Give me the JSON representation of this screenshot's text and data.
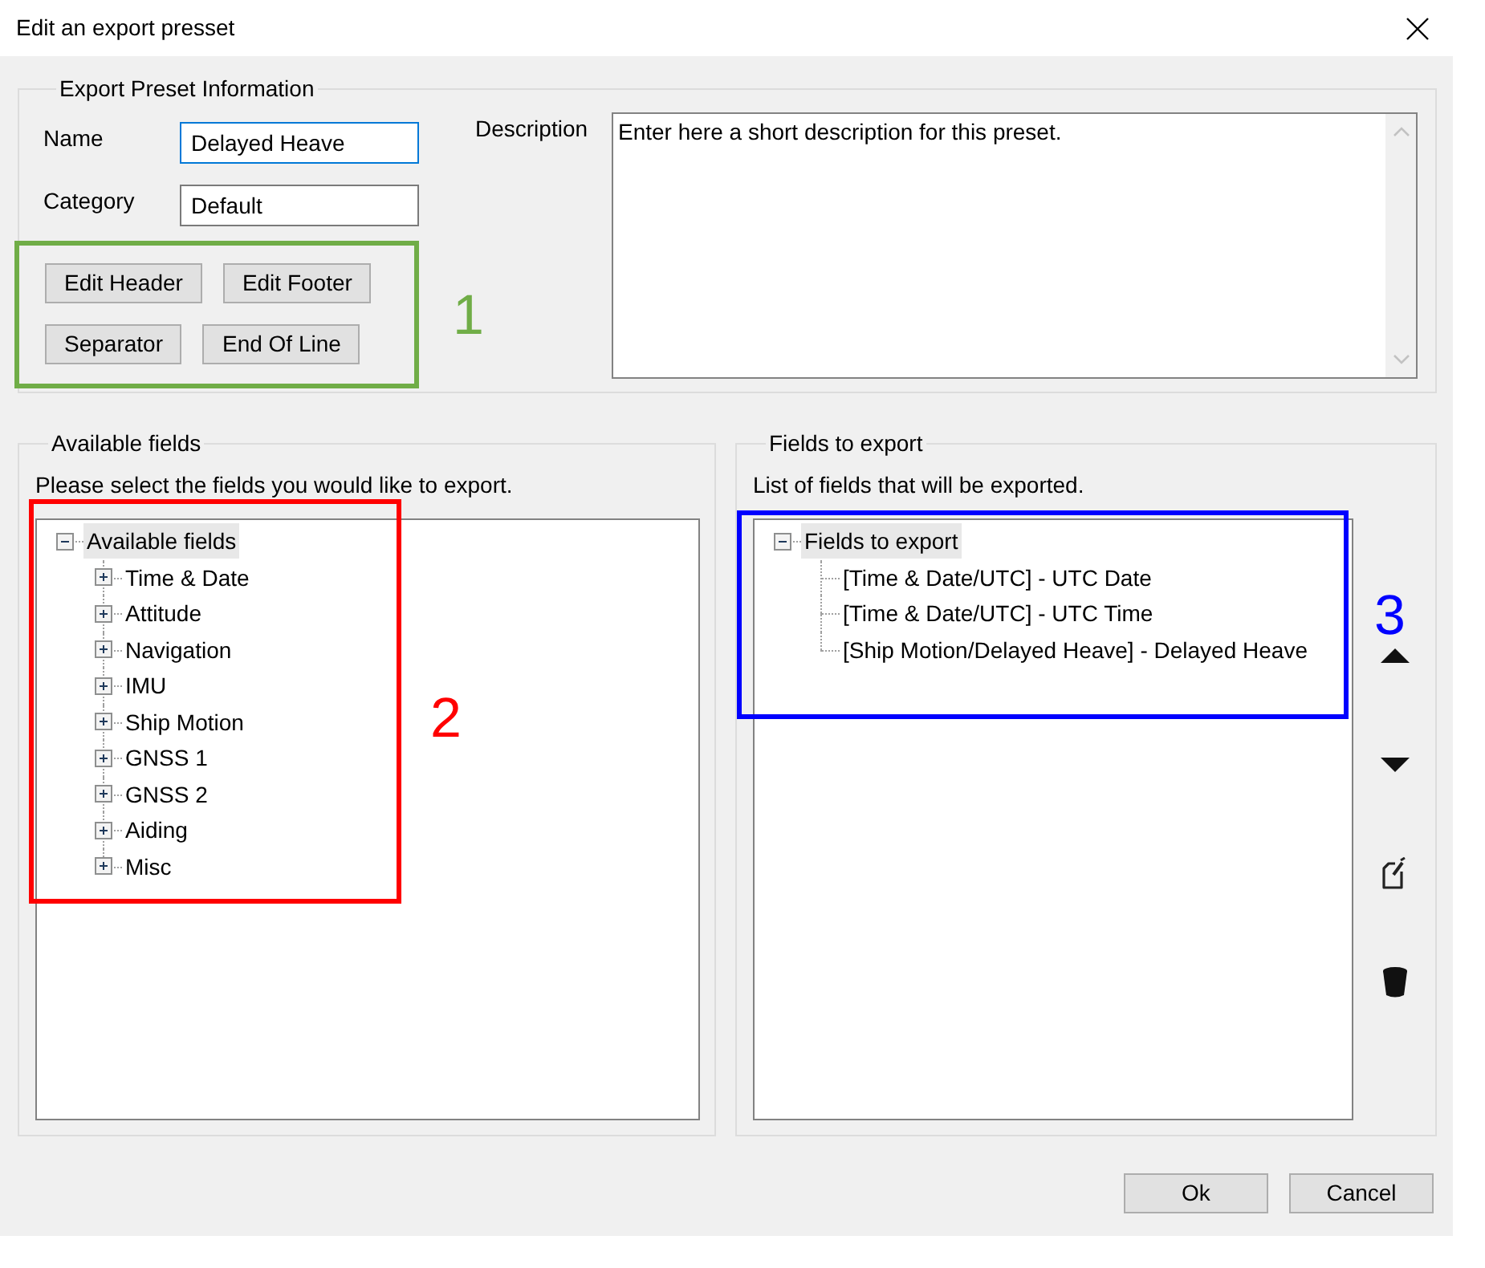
{
  "window": {
    "title": "Edit an export presset"
  },
  "preset_info": {
    "legend": "Export Preset Information",
    "name": {
      "label": "Name",
      "value": "Delayed Heave",
      "focused": true
    },
    "category": {
      "label": "Category",
      "value": "Default",
      "focused": false
    },
    "buttons": [
      "Edit Header",
      "Edit Footer",
      "Separator",
      "End Of Line"
    ],
    "description": {
      "label": "Description",
      "value": "Enter here a short description for this preset."
    }
  },
  "available_fields": {
    "legend": "Available fields",
    "hint": "Please select the fields you would like to export.",
    "tree": [
      {
        "label": "Available fields",
        "selected": true,
        "expanded": true,
        "children": [
          {
            "label": "Time & Date",
            "selected": false,
            "expanded": false
          },
          {
            "label": "Attitude",
            "selected": false,
            "expanded": false
          },
          {
            "label": "Navigation",
            "selected": false,
            "expanded": false
          },
          {
            "label": "IMU",
            "selected": false,
            "expanded": false
          },
          {
            "label": "Ship Motion",
            "selected": false,
            "expanded": false
          },
          {
            "label": "GNSS 1",
            "selected": false,
            "expanded": false
          },
          {
            "label": "GNSS 2",
            "selected": false,
            "expanded": false
          },
          {
            "label": "Aiding",
            "selected": false,
            "expanded": false
          },
          {
            "label": "Misc",
            "selected": false,
            "expanded": false
          }
        ]
      }
    ]
  },
  "fields_to_export": {
    "legend": "Fields to export",
    "hint": "List of fields that will be exported.",
    "tree": [
      {
        "label": "Fields to export",
        "selected": true,
        "expanded": true,
        "children": [
          {
            "label": "[Time & Date/UTC] - UTC Date",
            "selected": false
          },
          {
            "label": "[Time & Date/UTC] - UTC Time",
            "selected": false
          },
          {
            "label": "[Ship Motion/Delayed Heave] - Delayed Heave",
            "selected": false
          }
        ]
      }
    ]
  },
  "dialog_buttons": [
    "Ok",
    "Cancel"
  ],
  "annotations": [
    {
      "label": "1",
      "color": "#70ad47"
    },
    {
      "label": "2",
      "color": "#ff0000"
    },
    {
      "label": "3",
      "color": "#0000ff"
    }
  ]
}
